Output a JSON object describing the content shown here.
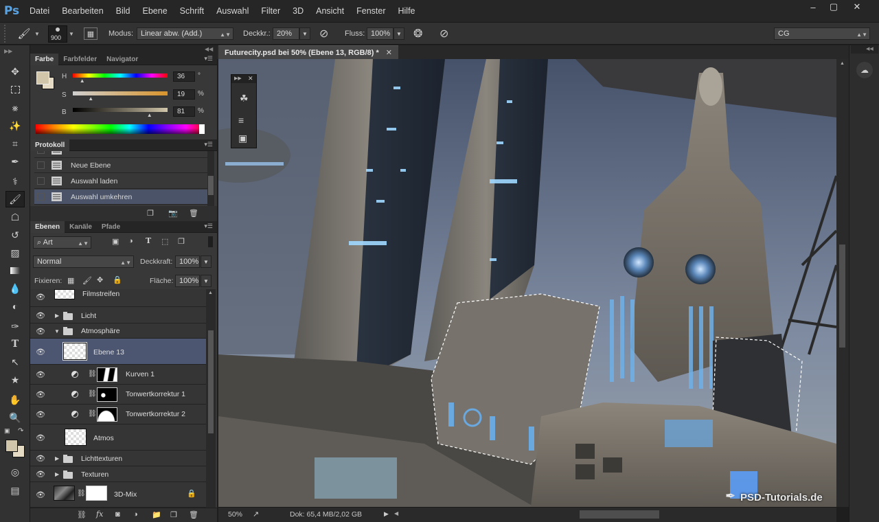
{
  "app": {
    "logo": "Ps"
  },
  "menu": [
    "Datei",
    "Bearbeiten",
    "Bild",
    "Ebene",
    "Schrift",
    "Auswahl",
    "Filter",
    "3D",
    "Ansicht",
    "Fenster",
    "Hilfe"
  ],
  "window_controls": {
    "minimize": "–",
    "restore": "▢",
    "close": "✕"
  },
  "options": {
    "brush_size": "900",
    "mode_label": "Modus:",
    "mode_value": "Linear abw. (Add.)",
    "opacity_label": "Deckkr.:",
    "opacity_value": "20%",
    "flow_label": "Fluss:",
    "flow_value": "100%",
    "workspace": "CG"
  },
  "color_panel": {
    "tabs": [
      "Farbe",
      "Farbfelder",
      "Navigator"
    ],
    "h_label": "H",
    "h_value": "36",
    "h_unit": "°",
    "s_label": "S",
    "s_value": "19",
    "s_unit": "%",
    "b_label": "B",
    "b_value": "81",
    "b_unit": "%",
    "foreground": "#d1c6aa",
    "background": "#e6dcc6"
  },
  "history_panel": {
    "title": "Protokoll",
    "items": [
      {
        "label": "Neue Ebene",
        "selected": false
      },
      {
        "label": "Auswahl laden",
        "selected": false
      },
      {
        "label": "Auswahl umkehren",
        "selected": true
      }
    ]
  },
  "layers_panel": {
    "tabs": [
      "Ebenen",
      "Kanäle",
      "Pfade"
    ],
    "filter": "Art",
    "blend_mode": "Normal",
    "opacity_label": "Deckkraft:",
    "opacity_value": "100%",
    "lock_label": "Fixieren:",
    "fill_label": "Fläche:",
    "fill_value": "100%",
    "layers": [
      {
        "name": "Filmstreifen",
        "kind": "pixel"
      },
      {
        "name": "Licht",
        "kind": "group"
      },
      {
        "name": "Atmosphäre",
        "kind": "group-open"
      },
      {
        "name": "Ebene 13",
        "kind": "pixel-selected"
      },
      {
        "name": "Kurven 1",
        "kind": "adjustment"
      },
      {
        "name": "Tonwertkorrektur 1",
        "kind": "adjustment"
      },
      {
        "name": "Tonwertkorrektur 2",
        "kind": "adjustment"
      },
      {
        "name": "Atmos",
        "kind": "pixel"
      },
      {
        "name": "Lichttexturen",
        "kind": "group"
      },
      {
        "name": "Texturen",
        "kind": "group"
      },
      {
        "name": "3D-Mix",
        "kind": "smart-locked"
      }
    ]
  },
  "document": {
    "tab_title": "Futurecity.psd bei 50% (Ebene 13, RGB/8) *",
    "zoom": "50%",
    "doc_info": "Dok: 65,4 MB/2,02 GB",
    "watermark": "PSD-Tutorials.de"
  }
}
